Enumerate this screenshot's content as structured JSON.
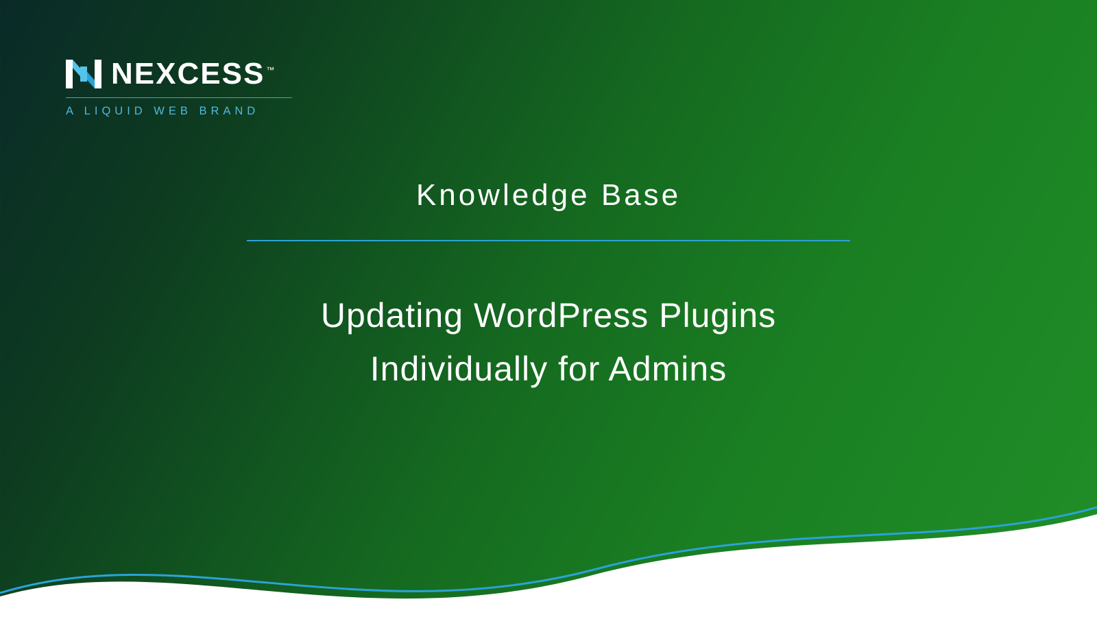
{
  "brand": {
    "name": "NEXCESS",
    "tm": "™",
    "tagline": "A LIQUID WEB BRAND"
  },
  "page": {
    "eyebrow": "Knowledge Base",
    "title_line1": "Updating WordPress Plugins",
    "title_line2": "Individually for Admins"
  },
  "colors": {
    "accent_blue": "#2aa3d8",
    "logo_blue": "#4fb8e0"
  }
}
